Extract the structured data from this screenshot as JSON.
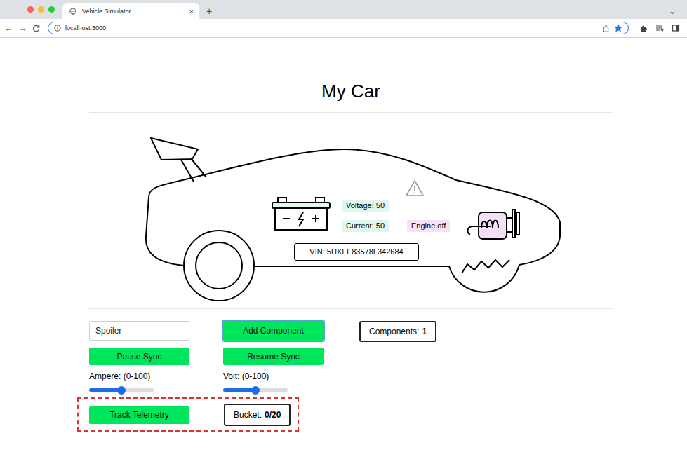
{
  "window": {
    "title": "Vehicle Simulator"
  },
  "tabs": [
    {
      "label": "Vehicle Simulator",
      "selected": true,
      "close": "×"
    }
  ],
  "new_tab": "+",
  "tab_menu": "⌄",
  "nav": [
    "←",
    "→"
  ],
  "address_bar": {
    "url": "localhost:3000",
    "focused": true,
    "bookmarked": true
  },
  "page": {
    "heading": "My Car"
  },
  "car": {
    "voltage": "Voltage: 50",
    "current": "Current: 50",
    "engine": "Engine off",
    "vin": "VIN: 5UXFE83578L342684",
    "warning": true
  },
  "controls": {
    "component_input": {
      "value": "Spoiler"
    },
    "buttons": [
      {
        "label": "Add Component",
        "focused": true
      },
      {
        "label": "Pause Sync",
        "focused": false
      },
      {
        "label": "Resume Sync",
        "focused": false
      }
    ],
    "components": {
      "label": "Components:",
      "value": "1"
    },
    "sliders": [
      {
        "label": "Ampere: (0-100)",
        "level": 0.5
      },
      {
        "label": "Volt: (0-100)",
        "level": 0.5
      }
    ],
    "telemetry": {
      "button": "Track Telemetry",
      "bucket_label": "Bucket:",
      "bucket_value": "0/20",
      "highlighted": true
    }
  }
}
